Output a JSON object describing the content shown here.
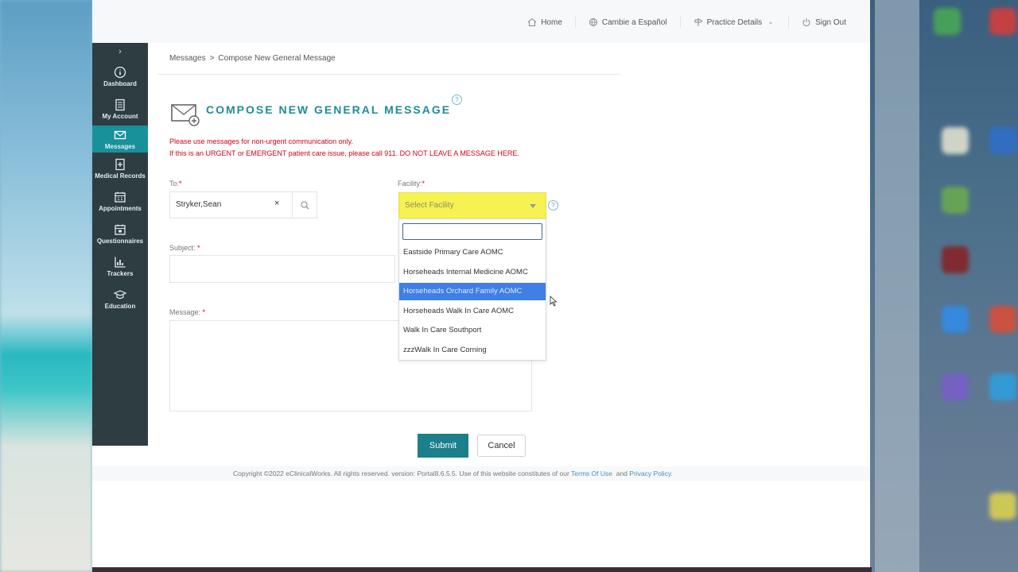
{
  "topnav": {
    "home": "Home",
    "language": "Cambie a Español",
    "practice": "Practice Details",
    "signout": "Sign Out"
  },
  "sidebar": {
    "items": [
      {
        "label": "Dashboard",
        "icon": "info-icon"
      },
      {
        "label": "My Account",
        "icon": "document-icon"
      },
      {
        "label": "Messages",
        "icon": "envelope-icon"
      },
      {
        "label": "Medical Records",
        "icon": "medical-record-icon"
      },
      {
        "label": "Appointments",
        "icon": "calendar-icon"
      },
      {
        "label": "Questionnaires",
        "icon": "calendar-check-icon"
      },
      {
        "label": "Trackers",
        "icon": "chart-icon"
      },
      {
        "label": "Education",
        "icon": "graduation-cap-icon"
      }
    ]
  },
  "breadcrumb": {
    "root": "Messages",
    "separator": ">",
    "current": "Compose New General Message"
  },
  "page": {
    "title": "COMPOSE NEW GENERAL MESSAGE",
    "warning_line1": "Please use messages for non-urgent communication only.",
    "warning_line2": "If this is an URGENT or EMERGENT patient care issue, please call 911. DO NOT LEAVE A MESSAGE HERE."
  },
  "form": {
    "to_label": "To:",
    "to_value": "Stryker,Sean",
    "to_clear": "×",
    "facility_label": "Facility:",
    "facility_placeholder": "Select Facility",
    "subject_label": "Subject:",
    "message_label": "Message:",
    "required_mark": "*",
    "help_mark": "?"
  },
  "facility_options": [
    "Eastside Primary Care AOMC",
    "Horseheads Internal Medicine AOMC",
    "Horseheads Orchard Family AOMC",
    "Horseheads Walk In Care AOMC",
    "Walk In Care Southport",
    "zzzWalk In Care Corning"
  ],
  "highlighted_option": "Horseheads Orchard Family AOMC",
  "buttons": {
    "submit": "Submit",
    "cancel": "Cancel"
  },
  "footer": {
    "text": "Copyright ©2022 eClinicalWorks. All rights reserved. version: Portal8.6.5.5.  Use of this website constitutes of our",
    "terms": "Terms Of Use",
    "and": "and",
    "privacy": "Privacy Policy."
  },
  "colors": {
    "accent": "#1f8c99",
    "sidebar": "#2e3d42",
    "sidebar_active": "#19919b",
    "facility_highlight": "#f5f251",
    "option_highlight": "#3f7fe6",
    "warning": "#d0021b"
  }
}
